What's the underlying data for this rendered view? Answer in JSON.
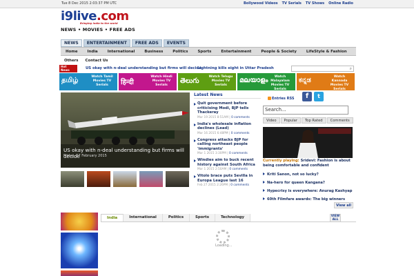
{
  "topbar": {
    "datetime": "Tue 8 Dec 2015 2:03:37 PM UTC",
    "links": [
      "Bollywood Videos",
      "TV Serials",
      "TV Shows",
      "Online Radio"
    ]
  },
  "logo": {
    "site": "i9live",
    "domain": ".com",
    "tagline": "Bringing India to the world",
    "strap": "NEWS • MOVIES • FREE ADS"
  },
  "section_tabs": [
    "NEWS",
    "ENTERTAINMENT",
    "FREE ADS",
    "EVENTS"
  ],
  "main_nav": [
    "Home",
    "India",
    "International",
    "Business",
    "Politics",
    "Sports",
    "Entertainment",
    "People & Society",
    "LifeStyle & Fashion"
  ],
  "sub_nav": [
    "Others",
    "Contact Us"
  ],
  "hot": {
    "label1": "Hot",
    "label2": "News",
    "item1": "US okay with n-deal understanding but firms will decide",
    "item2": "Lightning kills eight in Uttar Pradesh"
  },
  "banners": [
    {
      "script": "தமிழ்",
      "text": "Watch Tamil Movies TV Serials",
      "color": "#1f8ec4"
    },
    {
      "script": "हिन्दी",
      "text": "Watch Hindi Movies TV Serials",
      "color": "#c2178d"
    },
    {
      "script": "తెలుగు",
      "text": "Watch Telugu Movies TV Serials",
      "color": "#5e9e12"
    },
    {
      "script": "മലയാളം",
      "text": "Watch Malayalam Movies TV Serials",
      "color": "#269a3a"
    },
    {
      "script": "ಕನ್ನಡ",
      "text": "Watch Kannada Movies TV Serials",
      "color": "#e07b16"
    }
  ],
  "slider": {
    "caption": "US okay with n-deal understanding but firms will decide",
    "date": "Friday, 27 February 2015"
  },
  "latest": {
    "title": "Latest News",
    "items": [
      {
        "title": "Quit government before criticising Modi, BJP tells Thackeray",
        "date": "Mar 19 2015 8:51AM",
        "comments": "0 comments"
      },
      {
        "title": "India's wholesale inflation declines (Lead)",
        "date": "Mar 16 2015 6:48PM",
        "comments": "0 comments"
      },
      {
        "title": "Congress attacks BJP for calling northeast people 'immigrants'",
        "date": "Mar 1 2015 3:30PM",
        "comments": "0 comments"
      },
      {
        "title": "Windies aim to buck recent history against South Africa",
        "date": "Mar 1 2015 2:50AM",
        "comments": "0 comments"
      },
      {
        "title": "Vitolo brace puts Sevilla in Europa League last 16",
        "date": "Feb 27 2015 2:26PM",
        "comments": "0 comments"
      }
    ]
  },
  "rss": "Entries RSS",
  "search": {
    "placeholder": "Search..."
  },
  "video_tabs": [
    "Video",
    "Popular",
    "Top Rated",
    "Comments"
  ],
  "now_playing": {
    "label": "Currently playing:",
    "title": "Sridevi: Fashion is about being comfortable and confident"
  },
  "video_list": [
    "Kriti Sanon, not so lucky?",
    "Na-hero for queen Kangana?",
    "Hypecrisy is everywhere: Anurag Kashyap",
    "60th Filmfare awards: The big winners"
  ],
  "view_all": "View all",
  "bottom_tabs": [
    "India",
    "International",
    "Politics",
    "Sports",
    "Technology"
  ],
  "view_all_short": "VIEW ALL",
  "loading": "Loading..."
}
